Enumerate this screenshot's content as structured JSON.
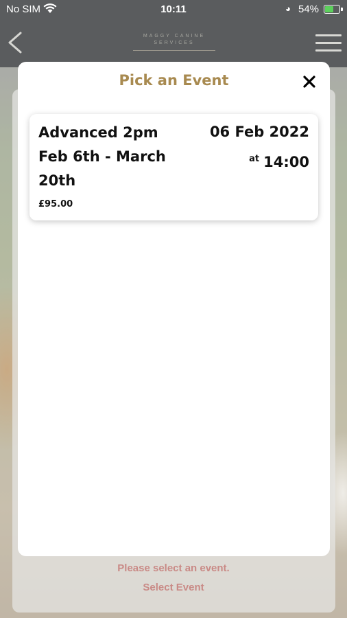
{
  "status_bar": {
    "carrier": "No SIM",
    "time": "10:11",
    "battery": "54%",
    "battery_level": 0.54
  },
  "header": {
    "logo_line1": "MAGGY CANINE",
    "logo_line2": "SERVICES"
  },
  "modal": {
    "title": "Pick an Event",
    "events": [
      {
        "name": "Advanced 2pm Feb 6th - March 20th",
        "price": "£95.00",
        "date": "06 Feb 2022",
        "at_label": "at",
        "time": "14:00"
      }
    ]
  },
  "footer": {
    "message": "Please select an event.",
    "select_label": "Select Event"
  },
  "colors": {
    "accent_gold": "#a88a50",
    "error_text": "#c98a86",
    "header_bg": "#5a5c5e"
  }
}
